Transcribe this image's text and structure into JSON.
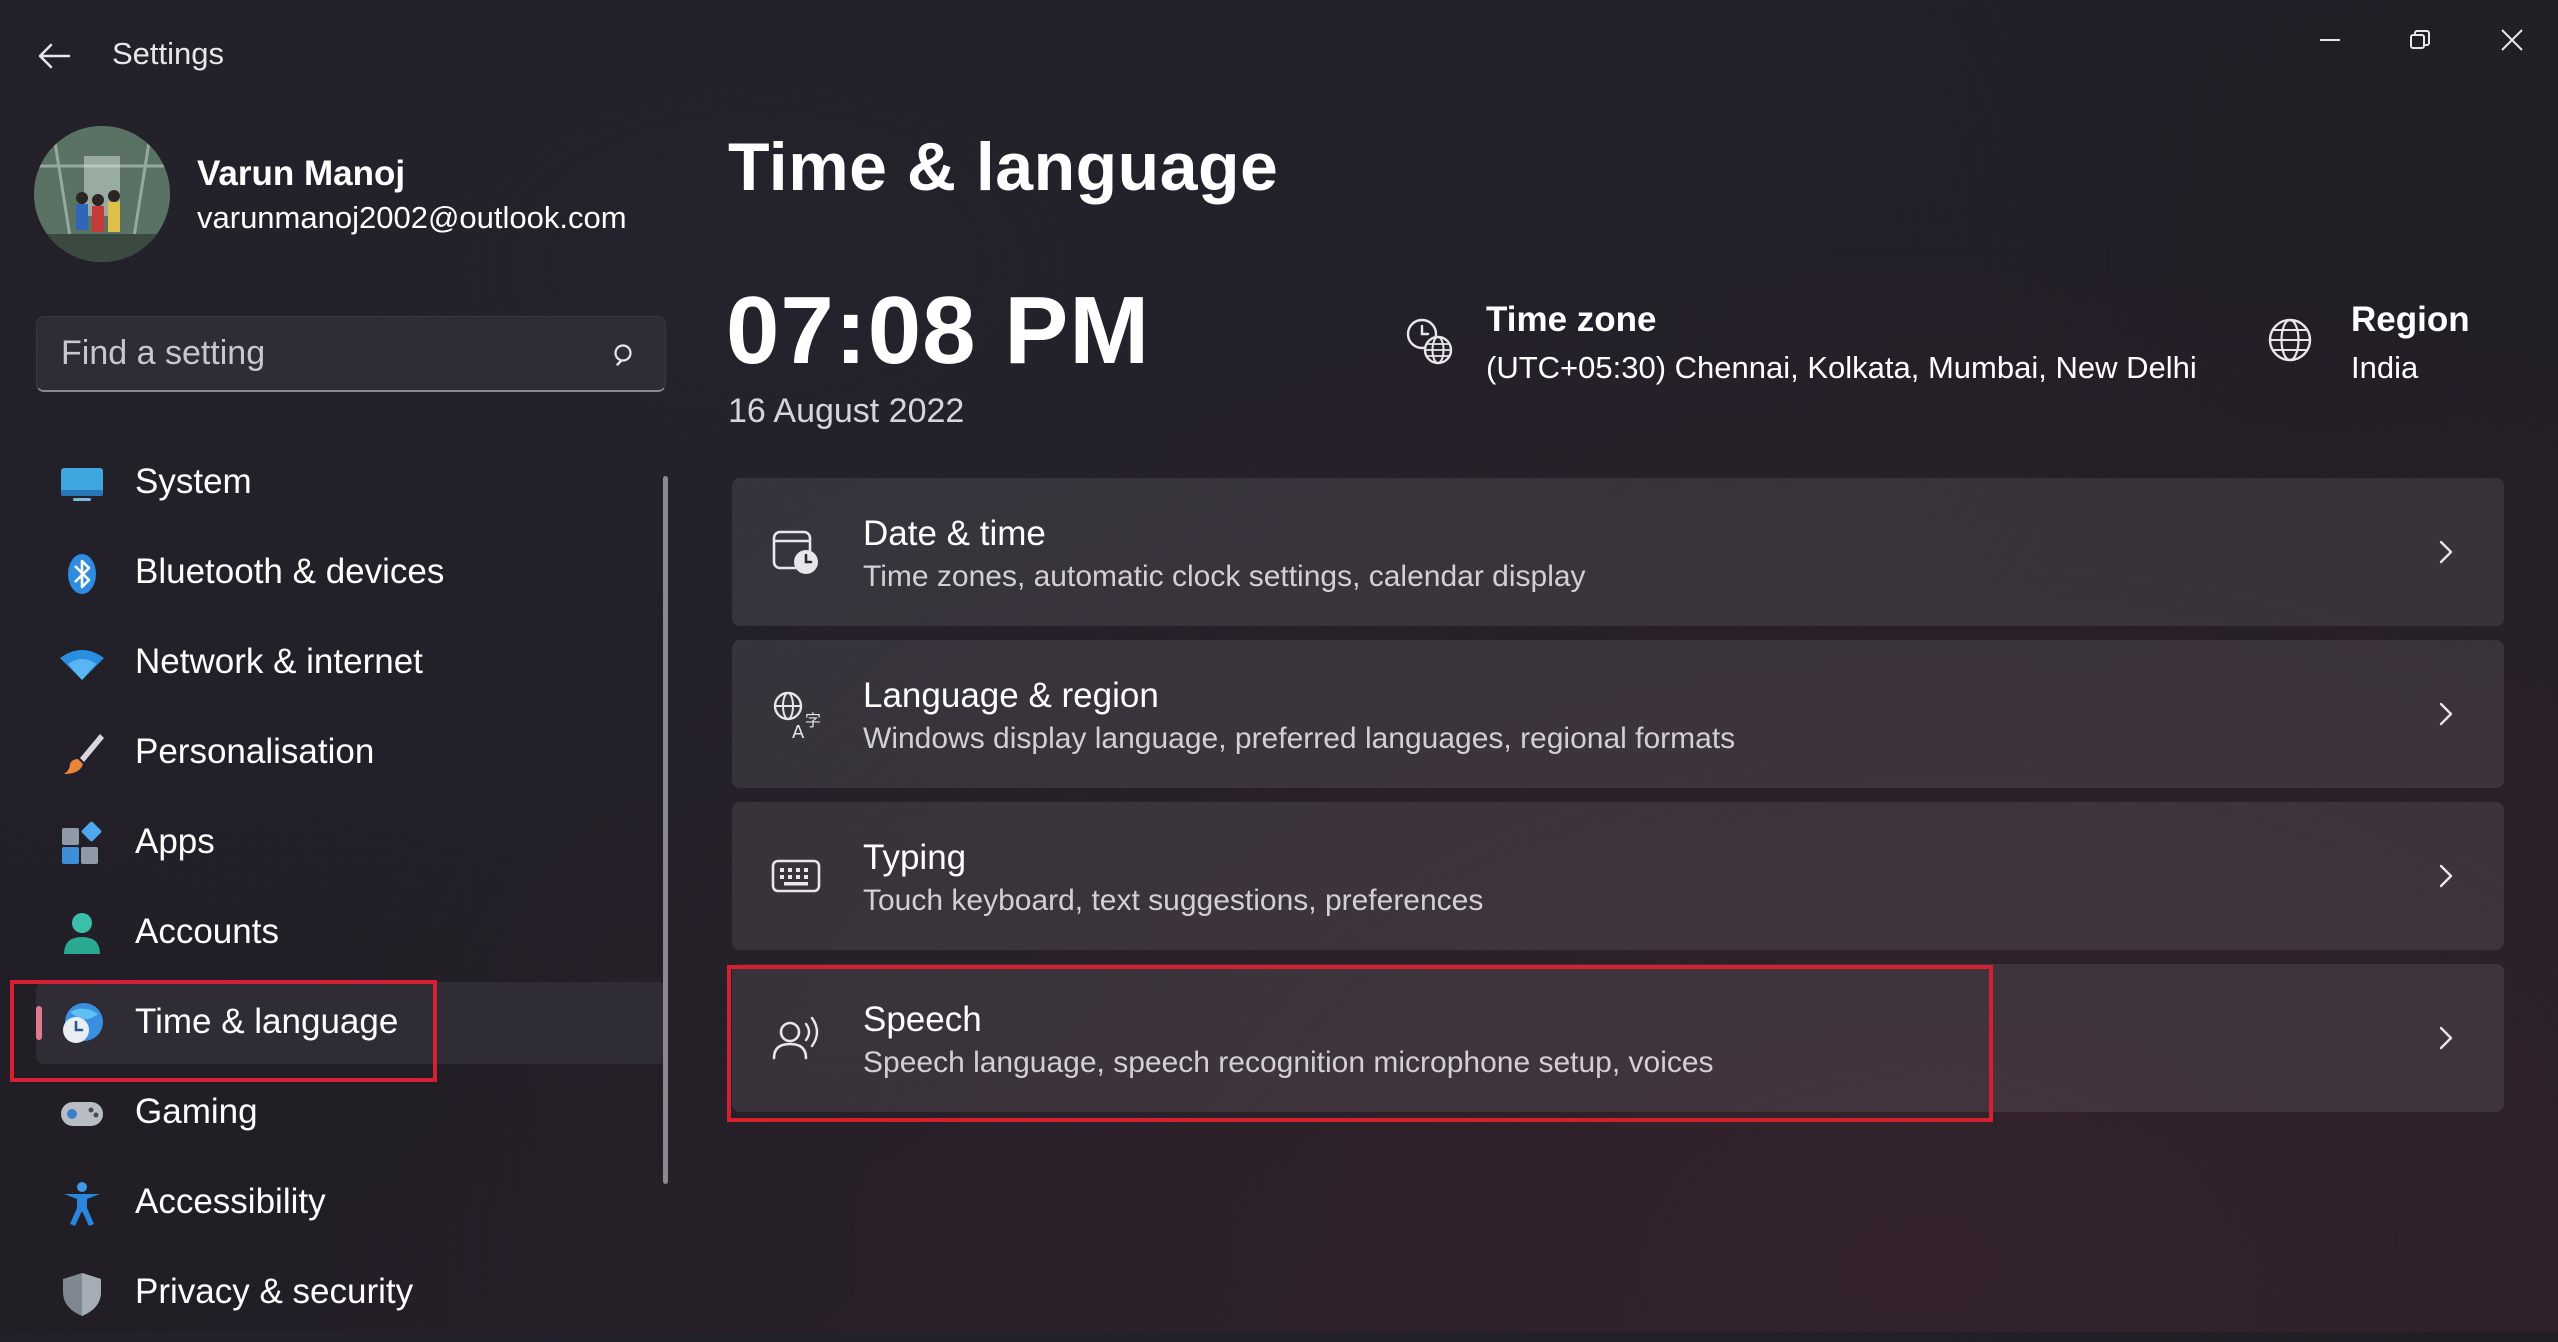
{
  "window": {
    "title": "Settings",
    "back_icon": "arrow-left-icon",
    "minimize_icon": "minimize-icon",
    "restore_icon": "restore-icon",
    "close_icon": "close-icon"
  },
  "profile": {
    "name": "Varun Manoj",
    "email": "varunmanoj2002@outlook.com"
  },
  "search": {
    "placeholder": "Find a setting",
    "icon": "search-icon"
  },
  "sidebar": {
    "items": [
      {
        "label": "System",
        "icon": "system-icon",
        "selected": false
      },
      {
        "label": "Bluetooth & devices",
        "icon": "bluetooth-icon",
        "selected": false
      },
      {
        "label": "Network & internet",
        "icon": "wifi-icon",
        "selected": false
      },
      {
        "label": "Personalisation",
        "icon": "brush-icon",
        "selected": false
      },
      {
        "label": "Apps",
        "icon": "apps-icon",
        "selected": false
      },
      {
        "label": "Accounts",
        "icon": "accounts-icon",
        "selected": false
      },
      {
        "label": "Time & language",
        "icon": "time-language-icon",
        "selected": true
      },
      {
        "label": "Gaming",
        "icon": "gamepad-icon",
        "selected": false
      },
      {
        "label": "Accessibility",
        "icon": "accessibility-icon",
        "selected": false
      },
      {
        "label": "Privacy & security",
        "icon": "shield-icon",
        "selected": false
      }
    ]
  },
  "main": {
    "title": "Time & language",
    "clock": {
      "time": "07:08 PM",
      "date": "16 August 2022"
    },
    "time_zone": {
      "label": "Time zone",
      "value": "(UTC+05:30) Chennai, Kolkata, Mumbai, New Delhi",
      "icon": "time-zone-icon"
    },
    "region": {
      "label": "Region",
      "value": "India",
      "icon": "globe-icon"
    },
    "cards": [
      {
        "title": "Date & time",
        "description": "Time zones, automatic clock settings, calendar display",
        "icon": "calendar-clock-icon"
      },
      {
        "title": "Language & region",
        "description": "Windows display language, preferred languages, regional formats",
        "icon": "language-icon"
      },
      {
        "title": "Typing",
        "description": "Touch keyboard, text suggestions, preferences",
        "icon": "keyboard-icon"
      },
      {
        "title": "Speech",
        "description": "Speech language, speech recognition microphone setup, voices",
        "icon": "speech-icon"
      }
    ]
  },
  "colors": {
    "accent": "#e07a8f",
    "highlight_box": "#d61f30",
    "background": "#221f28",
    "card": "#34313a"
  }
}
